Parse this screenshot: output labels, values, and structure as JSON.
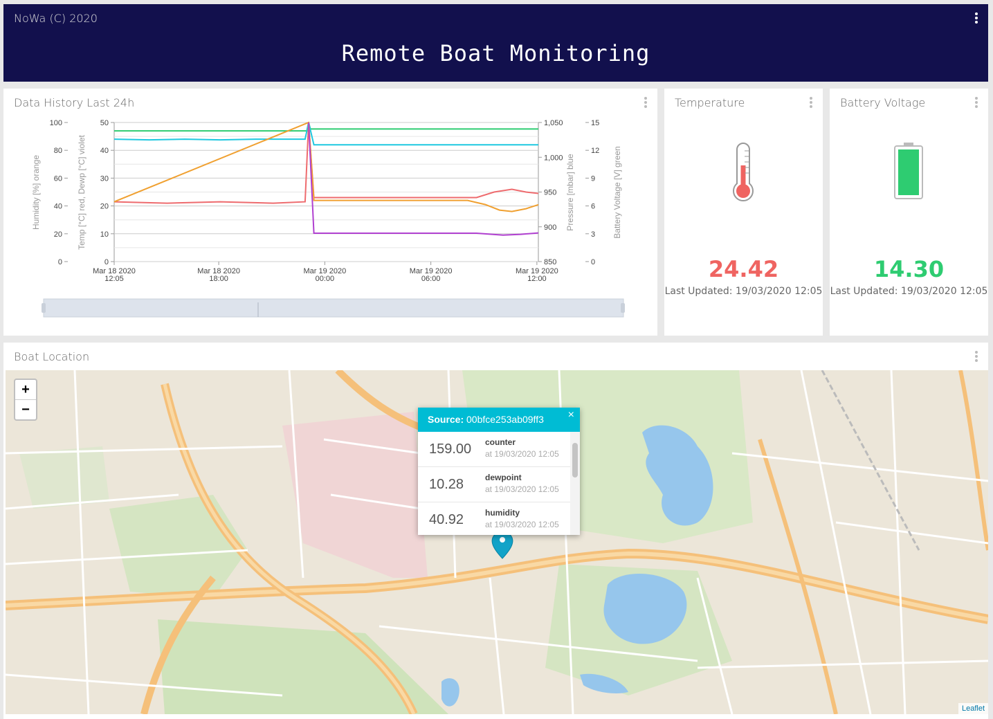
{
  "header": {
    "brand": "NoWa (C) 2020",
    "title": "Remote Boat Monitoring",
    "menu_icon": "vertical-dots-icon",
    "bg_color": "#12104d"
  },
  "history": {
    "title": "Data History Last 24h",
    "axes": {
      "y_humidity": {
        "label": "Humidity [%] orange",
        "ticks": [
          "100",
          "80",
          "60",
          "40",
          "20",
          "0"
        ]
      },
      "y_temp": {
        "label": "Temp [°C] red, Dewp [°C] violet",
        "ticks": [
          "50",
          "40",
          "30",
          "20",
          "10",
          "0"
        ]
      },
      "y_pressure": {
        "label": "Pressure  [mbar] blue",
        "ticks": [
          "1,050",
          "1,000",
          "950",
          "900",
          "850"
        ]
      },
      "y_voltage": {
        "label": "Battery Voltage [V] green",
        "ticks": [
          "15",
          "12",
          "9",
          "6",
          "3",
          "0"
        ]
      },
      "x_ticks": [
        {
          "l1": "Mar 18 2020",
          "l2": "12:05"
        },
        {
          "l1": "Mar 18 2020",
          "l2": "18:00"
        },
        {
          "l1": "Mar 19 2020",
          "l2": "00:00"
        },
        {
          "l1": "Mar 19 2020",
          "l2": "06:00"
        },
        {
          "l1": "Mar 19 2020",
          "l2": "12:00"
        }
      ]
    }
  },
  "chart_data": {
    "type": "line",
    "x_unit": "hours since Mar 18 2020 12:05",
    "x_range": [
      0,
      24
    ],
    "ylim_temp": [
      0,
      50
    ],
    "ylim_humidity": [
      0,
      100
    ],
    "ylim_pressure": [
      850,
      1050
    ],
    "ylim_voltage": [
      0,
      15
    ],
    "grid": true,
    "series": [
      {
        "name": "Battery Voltage [V] green",
        "axis": "voltage",
        "color": "#2ecc71",
        "x": [
          0,
          10.9,
          11.0,
          11.1,
          12.5,
          24
        ],
        "y": [
          14.1,
          14.1,
          15,
          14.3,
          14.3,
          14.3
        ]
      },
      {
        "name": "Pressure  [mbar] blue",
        "axis": "pressure",
        "color": "#1ec8e0",
        "x": [
          0,
          2,
          4,
          6,
          8,
          10.8,
          11.0,
          11.3,
          18,
          24
        ],
        "y": [
          1026,
          1025,
          1026,
          1025,
          1026,
          1026,
          1050,
          1018,
          1018,
          1018
        ]
      },
      {
        "name": "Temp [°C] red",
        "axis": "temp",
        "color": "#ee6b6e",
        "x": [
          0,
          3,
          6,
          9,
          10.8,
          11.0,
          11.3,
          16,
          20.5,
          21.5,
          22.5,
          23.3,
          24
        ],
        "y": [
          21.5,
          21.0,
          21.5,
          21.0,
          21.5,
          50,
          23.0,
          23.0,
          23.0,
          25.0,
          26.0,
          25.0,
          24.5
        ]
      },
      {
        "name": "Humidity [%] orange",
        "axis": "humidity",
        "color": "#f0a030",
        "x": [
          0,
          11.0,
          11.3,
          20.0,
          21.0,
          21.8,
          22.5,
          23.3,
          24
        ],
        "y": [
          43,
          100,
          44,
          44,
          41,
          37,
          36,
          38,
          40.9
        ]
      },
      {
        "name": "Dewp [°C] violet",
        "axis": "temp",
        "color": "#b040d0",
        "x": [
          0,
          10.9,
          11.0,
          11.3,
          20.5,
          22,
          23,
          24
        ],
        "y": [
          null,
          null,
          50,
          10.2,
          10.2,
          9.5,
          9.8,
          10.3
        ]
      }
    ]
  },
  "temperature": {
    "title": "Temperature",
    "value": "24.42",
    "updated": "Last Updated: 19/03/2020 12:05",
    "icon": "thermometer-icon",
    "color": "#ef6461"
  },
  "battery": {
    "title": "Battery Voltage",
    "value": "14.30",
    "updated": "Last Updated: 19/03/2020 12:05",
    "icon": "battery-icon",
    "color": "#2ecc71"
  },
  "location": {
    "title": "Boat Location",
    "zoom_in": "+",
    "zoom_out": "−",
    "attribution": "Leaflet",
    "popup": {
      "source_label": "Source:",
      "source_id": "00bfce253ab09ff3",
      "close": "×",
      "rows": [
        {
          "value": "159.00",
          "label": "counter",
          "time": "at 19/03/2020 12:05"
        },
        {
          "value": "10.28",
          "label": "dewpoint",
          "time": "at 19/03/2020 12:05"
        },
        {
          "value": "40.92",
          "label": "humidity",
          "time": "at 19/03/2020 12:05"
        }
      ]
    }
  }
}
